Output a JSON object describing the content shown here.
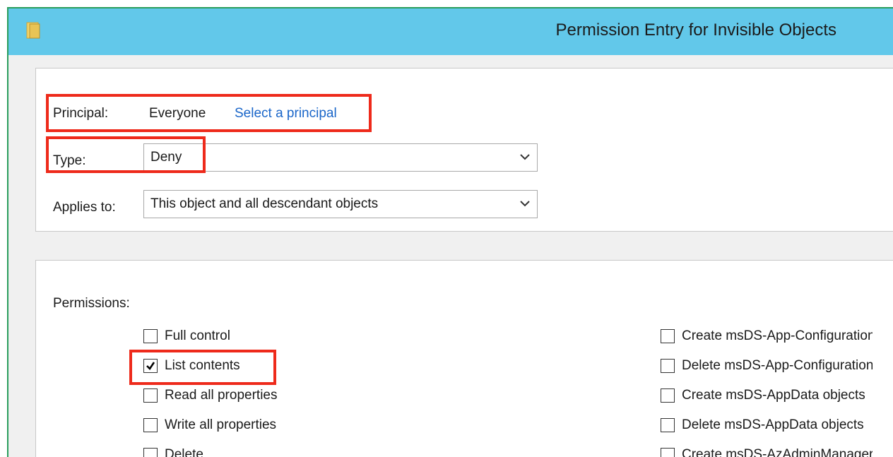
{
  "window": {
    "title": "Permission Entry for Invisible Objects",
    "titlebar_color": "#62c8ea",
    "highlight_color": "#ee2a1b"
  },
  "principal": {
    "label": "Principal:",
    "value": "Everyone",
    "link": "Select a principal"
  },
  "type": {
    "label": "Type:",
    "value": "Deny"
  },
  "applies_to": {
    "label": "Applies to:",
    "value": "This object and all descendant objects"
  },
  "permissions": {
    "title": "Permissions:",
    "left": [
      {
        "label": "Full control",
        "checked": false
      },
      {
        "label": "List contents",
        "checked": true
      },
      {
        "label": "Read all properties",
        "checked": false
      },
      {
        "label": "Write all properties",
        "checked": false
      },
      {
        "label": "Delete",
        "checked": false
      }
    ],
    "right": [
      {
        "label": "Create msDS-App-Configuration",
        "checked": false
      },
      {
        "label": "Delete msDS-App-Configuration",
        "checked": false
      },
      {
        "label": "Create msDS-AppData objects",
        "checked": false
      },
      {
        "label": "Delete msDS-AppData objects",
        "checked": false
      },
      {
        "label": "Create msDS-AzAdminManager",
        "checked": false
      }
    ]
  }
}
